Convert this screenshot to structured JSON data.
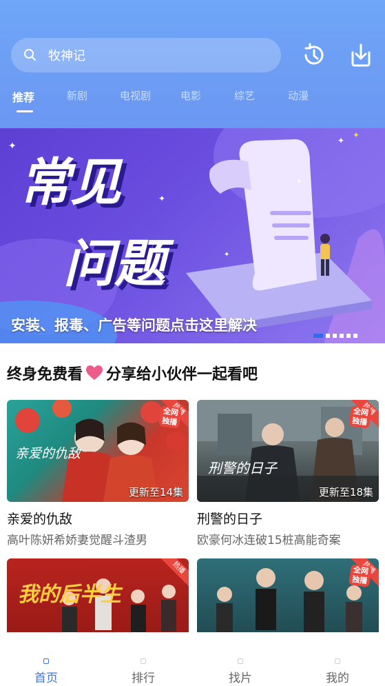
{
  "search": {
    "value": "牧神记"
  },
  "header_icons": [
    "history-icon",
    "download-icon"
  ],
  "tabs": [
    "推荐",
    "新剧",
    "电视剧",
    "电影",
    "综艺",
    "动漫"
  ],
  "active_tab": 0,
  "banner": {
    "headline_line1": "常见",
    "headline_line2": "问题",
    "caption": "安装、报毒、广告等问题点击这里解决",
    "slide_count": 6,
    "active_slide": 0
  },
  "section": {
    "title_left": "终身免费看",
    "title_right": "分享给小伙伴一起看吧"
  },
  "cards": [
    {
      "title": "亲爱的仇敌",
      "subtitle": "高叶陈妍希娇妻觉醒斗渣男",
      "episodes": "更新至14集",
      "hot": "热播",
      "exclusive": "全网独播"
    },
    {
      "title": "刑警的日子",
      "subtitle": "欧豪何冰连破15桩高能奇案",
      "episodes": "更新至18集",
      "hot": "热播",
      "exclusive": "全网独播"
    },
    {
      "title": "",
      "subtitle": "",
      "episodes": "",
      "hot": "热播",
      "exclusive": ""
    },
    {
      "title": "",
      "subtitle": "",
      "episodes": "",
      "hot": "热播",
      "exclusive": "全网独播"
    }
  ],
  "poster_titles": [
    "亲爱的仇敌",
    "刑警的日子",
    "我的后半生"
  ],
  "bottom_nav": [
    "首页",
    "排行",
    "找片",
    "我的"
  ],
  "active_nav": 0,
  "colors": {
    "header": "#6fa6f7",
    "accent": "#3a74e6",
    "hot": "#e9473e",
    "heart": "#ec5b8a"
  }
}
